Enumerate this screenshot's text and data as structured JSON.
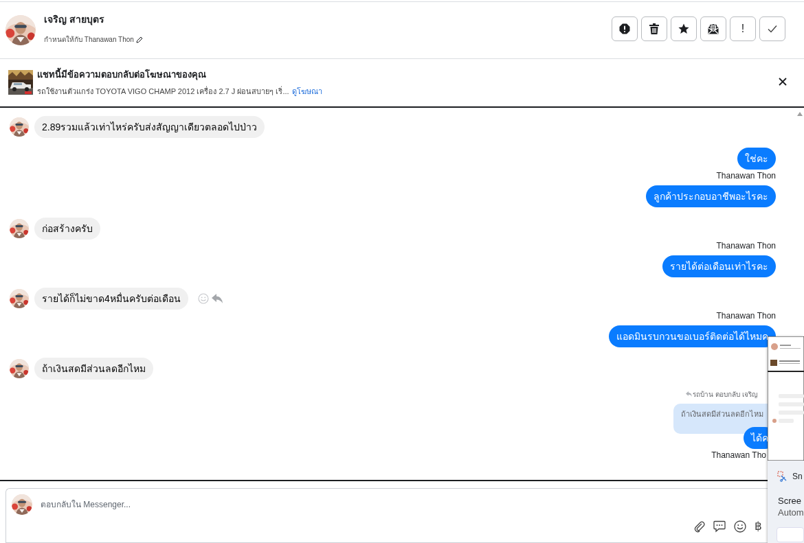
{
  "contact": {
    "name": "เจริญ สายบุตร",
    "assigned_label": "กำหนดให้กับ Thanawan Thon"
  },
  "actions": [
    {
      "kind": "alert"
    },
    {
      "kind": "trash"
    },
    {
      "kind": "star"
    },
    {
      "kind": "mail"
    },
    {
      "kind": "important",
      "label": "!"
    },
    {
      "kind": "done"
    }
  ],
  "ad": {
    "title": "แชทนี้มีข้อความตอบกลับต่อโฆษณาของคุณ",
    "description": "รถใช้งานตัวแกร่ง TOYOTA VIGO CHAMP 2012 เครื่อง 2.7 J ผ่อนสบายๆ เริ่...",
    "link": "ดูโฆษณา"
  },
  "messages": [
    {
      "kind": "incoming",
      "text": "2.89รวมแล้วเท่าไหร่ครับส่งสัญญาเดียวตลอดไปป่าว",
      "show_actions": false
    },
    {
      "kind": "outgoing",
      "text": "ใช่คะ"
    },
    {
      "kind": "sender",
      "text": "Thanawan Thon"
    },
    {
      "kind": "outgoing",
      "text": "ลูกค้าประกอบอาชีพอะไรคะ"
    },
    {
      "kind": "incoming",
      "text": "ก่อสร้างครับ",
      "show_actions": false
    },
    {
      "kind": "sender",
      "text": "Thanawan Thon"
    },
    {
      "kind": "outgoing",
      "text": "รายได้ต่อเดือนเท่าไรคะ"
    },
    {
      "kind": "incoming",
      "text": "รายได้ก็ไม่ขาด4หมื่นครับต่อเดือน",
      "show_actions": true
    },
    {
      "kind": "sender",
      "text": "Thanawan Thon"
    },
    {
      "kind": "outgoing",
      "text": "แอดมินรบกวนขอเบอร์ติดต่อได้ไหมค"
    },
    {
      "kind": "incoming",
      "text": "ถ้าเงินสดมีส่วนลดอีกไหม",
      "show_actions": false
    },
    {
      "kind": "reply_label",
      "text": "รถบ้าน ตอบกลับ เจริญ"
    },
    {
      "kind": "quote",
      "text": "ถ้าเงินสดมีส่วนลดอีกไหม"
    },
    {
      "kind": "outgoing",
      "text": "ได้ค"
    },
    {
      "kind": "sender",
      "text": "Thanawan Tho"
    }
  ],
  "composer": {
    "placeholder": "ตอบกลับใน Messenger...",
    "tools": [
      {
        "kind": "attach"
      },
      {
        "kind": "chat"
      },
      {
        "kind": "emoji"
      },
      {
        "kind": "currency",
        "label": "฿"
      }
    ]
  },
  "snip_toast": {
    "app": "Sn",
    "title": "Scree",
    "subtitle": "Autom"
  }
}
